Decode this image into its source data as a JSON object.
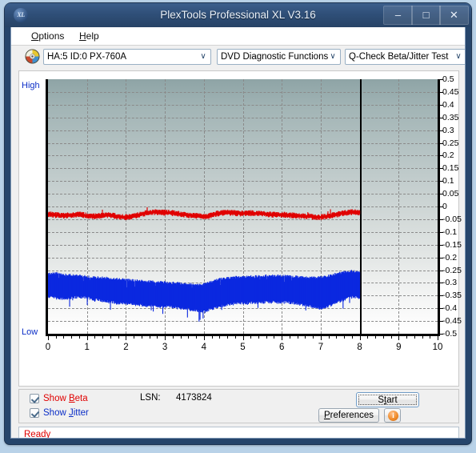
{
  "window": {
    "title": "PlexTools Professional XL V3.16",
    "icon": "xl-logo-icon",
    "buttons": {
      "minimize": "–",
      "maximize": "□",
      "close": "✕"
    }
  },
  "menubar": {
    "items": [
      {
        "label": "Options",
        "accel": "O"
      },
      {
        "label": "Help",
        "accel": "H"
      }
    ]
  },
  "toolbar": {
    "disc_icon": "optical-disc-icon",
    "drive_combo": {
      "value": "HA:5 ID:0  PX-760A",
      "arrow": "∨"
    },
    "function_combo": {
      "value": "DVD Diagnostic Functions",
      "arrow": "∨"
    },
    "test_combo": {
      "value": "Q-Check Beta/Jitter Test",
      "arrow": "∨"
    }
  },
  "chart_panel": {
    "axis_high_label": "High",
    "axis_low_label": "Low"
  },
  "controls": {
    "show_beta": {
      "label_prefix": "Show ",
      "label_accel": "B",
      "label_suffix": "eta",
      "checked": true,
      "color": "#e00000"
    },
    "show_jitter": {
      "label_prefix": "Show ",
      "label_accel": "J",
      "label_suffix": "itter",
      "checked": true,
      "color": "#0b2ec7"
    },
    "lsn_label": "LSN:",
    "lsn_value": "4173824",
    "start_button": {
      "prefix": "S",
      "accel": "t",
      "label_before": "S",
      "label_accel": "t",
      "label_after": "art"
    },
    "preferences_button": {
      "accel": "P",
      "label_after": "references"
    },
    "info_button": {
      "glyph": "i",
      "name": "info-icon"
    }
  },
  "statusbar": {
    "text": "Ready",
    "color": "#e00000"
  },
  "chart_data": {
    "type": "line",
    "title": "Q-Check Beta/Jitter Test",
    "xlabel": "",
    "ylabel": "",
    "xlim": [
      0,
      10
    ],
    "ylim": [
      -0.5,
      0.5
    ],
    "grid": true,
    "legend": "checkbox-toggles",
    "x_ticks": [
      0,
      1,
      2,
      3,
      4,
      5,
      6,
      7,
      8,
      9,
      10
    ],
    "y_ticks": [
      0.5,
      0.45,
      0.4,
      0.35,
      0.3,
      0.25,
      0.2,
      0.15,
      0.1,
      0.05,
      0,
      -0.05,
      -0.1,
      -0.15,
      -0.2,
      -0.25,
      -0.3,
      -0.35,
      -0.4,
      -0.45,
      -0.5
    ],
    "y_axis_endpoint_labels": {
      "top": "High",
      "bottom": "Low"
    },
    "data_end_x": 8,
    "series": [
      {
        "name": "Beta",
        "color": "#e00000",
        "visible": true,
        "description": "Beta value trace, roughly flat near -0.03",
        "x": [
          0.0,
          0.2,
          0.4,
          0.6,
          0.8,
          1.0,
          1.2,
          1.4,
          1.6,
          1.8,
          2.0,
          2.2,
          2.4,
          2.6,
          2.8,
          3.0,
          3.2,
          3.4,
          3.6,
          3.8,
          4.0,
          4.2,
          4.4,
          4.6,
          4.8,
          5.0,
          5.2,
          5.4,
          5.6,
          5.8,
          6.0,
          6.2,
          6.4,
          6.6,
          6.8,
          7.0,
          7.2,
          7.4,
          7.6,
          7.8,
          8.0
        ],
        "values": [
          -0.03,
          -0.034,
          -0.036,
          -0.033,
          -0.031,
          -0.036,
          -0.038,
          -0.036,
          -0.034,
          -0.04,
          -0.042,
          -0.038,
          -0.03,
          -0.024,
          -0.022,
          -0.024,
          -0.026,
          -0.03,
          -0.034,
          -0.036,
          -0.04,
          -0.034,
          -0.026,
          -0.024,
          -0.026,
          -0.028,
          -0.026,
          -0.028,
          -0.03,
          -0.032,
          -0.032,
          -0.034,
          -0.036,
          -0.038,
          -0.04,
          -0.042,
          -0.038,
          -0.032,
          -0.026,
          -0.022,
          -0.024
        ],
        "band_half_width": 0.012
      },
      {
        "name": "Jitter",
        "color": "#0b28e0",
        "visible": true,
        "description": "Jitter band, dense noise between approx -0.26 and -0.43",
        "x": [
          0.0,
          0.2,
          0.4,
          0.6,
          0.8,
          1.0,
          1.2,
          1.4,
          1.6,
          1.8,
          2.0,
          2.2,
          2.4,
          2.6,
          2.8,
          3.0,
          3.2,
          3.4,
          3.6,
          3.8,
          4.0,
          4.2,
          4.4,
          4.6,
          4.8,
          5.0,
          5.2,
          5.4,
          5.6,
          5.8,
          6.0,
          6.2,
          6.4,
          6.6,
          6.8,
          7.0,
          7.2,
          7.4,
          7.6,
          7.8,
          8.0
        ],
        "upper": [
          -0.265,
          -0.262,
          -0.268,
          -0.27,
          -0.272,
          -0.275,
          -0.278,
          -0.28,
          -0.282,
          -0.285,
          -0.288,
          -0.29,
          -0.292,
          -0.295,
          -0.296,
          -0.298,
          -0.3,
          -0.302,
          -0.304,
          -0.306,
          -0.305,
          -0.295,
          -0.285,
          -0.28,
          -0.278,
          -0.276,
          -0.275,
          -0.274,
          -0.272,
          -0.272,
          -0.272,
          -0.274,
          -0.276,
          -0.278,
          -0.28,
          -0.278,
          -0.272,
          -0.264,
          -0.258,
          -0.254,
          -0.256
        ],
        "lower": [
          -0.355,
          -0.36,
          -0.362,
          -0.358,
          -0.356,
          -0.358,
          -0.366,
          -0.372,
          -0.376,
          -0.38,
          -0.384,
          -0.386,
          -0.388,
          -0.39,
          -0.392,
          -0.394,
          -0.396,
          -0.4,
          -0.404,
          -0.41,
          -0.415,
          -0.402,
          -0.392,
          -0.386,
          -0.382,
          -0.38,
          -0.378,
          -0.378,
          -0.376,
          -0.376,
          -0.376,
          -0.378,
          -0.382,
          -0.388,
          -0.396,
          -0.4,
          -0.392,
          -0.378,
          -0.366,
          -0.356,
          -0.358
        ]
      }
    ]
  }
}
